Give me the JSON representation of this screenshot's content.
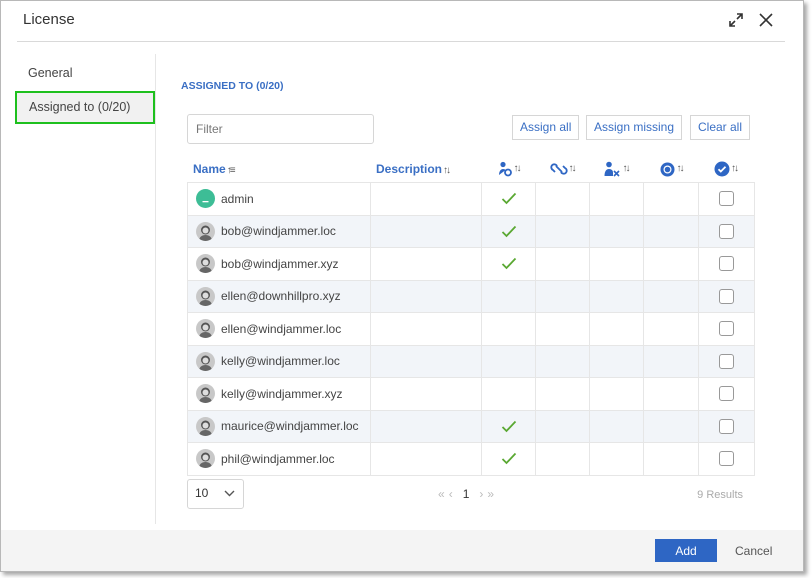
{
  "dialog": {
    "title": "License",
    "expand_icon": "expand-icon",
    "close_icon": "close-icon"
  },
  "sidebar": {
    "items": [
      {
        "label": "General",
        "active": false
      },
      {
        "label": "Assigned to (0/20)",
        "active": true
      }
    ]
  },
  "main": {
    "section_title": "ASSIGNED TO (0/20)",
    "filter_placeholder": "Filter",
    "filter_value": "",
    "buttons": {
      "assign_all": "Assign all",
      "assign_missing": "Assign missing",
      "clear_all": "Clear all"
    },
    "columns": {
      "name": "Name",
      "description": "Description",
      "icon_cols": [
        "user-settings-icon",
        "link-icon",
        "user-remove-icon",
        "badge-icon",
        "check-circle-icon"
      ],
      "sort_glyph": "↑↓"
    },
    "rows": [
      {
        "name": "admin",
        "description": "",
        "col1": true,
        "avatar": "initial",
        "selected": false
      },
      {
        "name": "bob@windjammer.loc",
        "description": "",
        "col1": true,
        "avatar": "photo",
        "selected": false
      },
      {
        "name": "bob@windjammer.xyz",
        "description": "",
        "col1": true,
        "avatar": "photo",
        "selected": false
      },
      {
        "name": "ellen@downhillpro.xyz",
        "description": "",
        "col1": false,
        "avatar": "photo",
        "selected": false
      },
      {
        "name": "ellen@windjammer.loc",
        "description": "",
        "col1": false,
        "avatar": "photo",
        "selected": false
      },
      {
        "name": "kelly@windjammer.loc",
        "description": "",
        "col1": false,
        "avatar": "photo",
        "selected": false
      },
      {
        "name": "kelly@windjammer.xyz",
        "description": "",
        "col1": false,
        "avatar": "photo",
        "selected": false
      },
      {
        "name": "maurice@windjammer.loc",
        "description": "",
        "col1": true,
        "avatar": "photo",
        "selected": false
      },
      {
        "name": "phil@windjammer.loc",
        "description": "",
        "col1": true,
        "avatar": "photo",
        "selected": false
      }
    ],
    "pagination": {
      "page_size": "10",
      "first": "«",
      "prev": "‹",
      "current_page": "1",
      "next": "›",
      "last": "»",
      "results": "9 Results"
    }
  },
  "footer": {
    "add_label": "Add",
    "cancel_label": "Cancel"
  },
  "colors": {
    "accent": "#3a6fc4",
    "primary_button": "#2e66c4",
    "active_outline": "#1ec01e",
    "check": "#5aa832",
    "admin_avatar": "#3dbd96"
  }
}
